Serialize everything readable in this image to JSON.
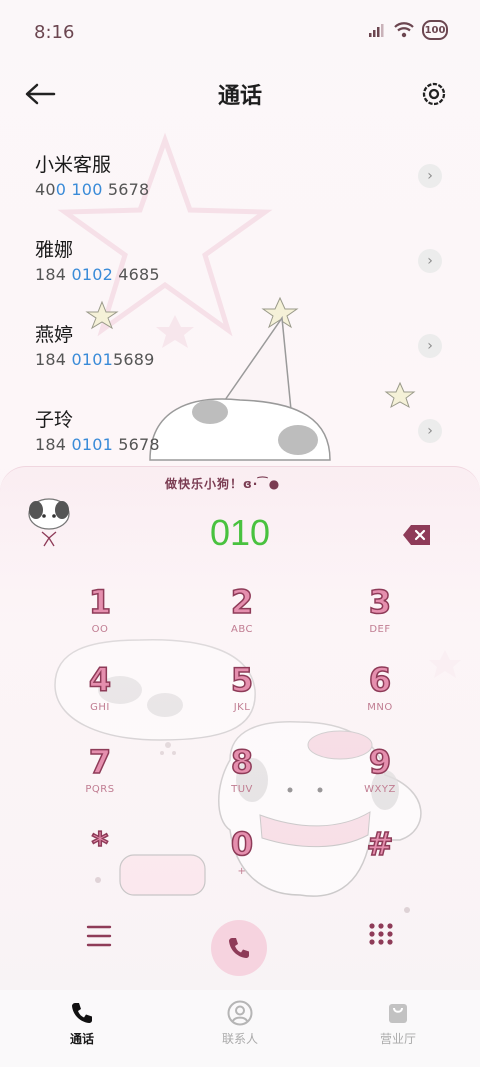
{
  "status_bar": {
    "time": "8:16",
    "battery": "100"
  },
  "header": {
    "title": "通话"
  },
  "suggestions": [
    {
      "name": "小米客服",
      "num_pre": "40",
      "num_hl": "0 100",
      "num_post": " 5678"
    },
    {
      "name": "雅娜",
      "num_pre": "184 ",
      "num_hl": "0102",
      "num_post": " 4685"
    },
    {
      "name": "燕婷",
      "num_pre": "184 ",
      "num_hl": "0101",
      "num_post": "5689"
    },
    {
      "name": "子玲",
      "num_pre": "184 ",
      "num_hl": "0101",
      "num_post": " 5678"
    }
  ],
  "dialer": {
    "banner": "做快乐小狗！ɞ·  ͡  ●",
    "number": "010",
    "keys": [
      {
        "digit": "1",
        "letters": "OO"
      },
      {
        "digit": "2",
        "letters": "ABC"
      },
      {
        "digit": "3",
        "letters": "DEF"
      },
      {
        "digit": "4",
        "letters": "GHI"
      },
      {
        "digit": "5",
        "letters": "JKL"
      },
      {
        "digit": "6",
        "letters": "MNO"
      },
      {
        "digit": "7",
        "letters": "PQRS"
      },
      {
        "digit": "8",
        "letters": "TUV"
      },
      {
        "digit": "9",
        "letters": "WXYZ"
      },
      {
        "digit": "*",
        "letters": ""
      },
      {
        "digit": "0",
        "letters": "+"
      },
      {
        "digit": "#",
        "letters": ""
      }
    ]
  },
  "bottom_nav": [
    {
      "label": "通话",
      "icon": "phone-icon",
      "active": true
    },
    {
      "label": "联系人",
      "icon": "contacts-icon",
      "active": false
    },
    {
      "label": "营业厅",
      "icon": "shopping-bag-icon",
      "active": false
    }
  ],
  "colors": {
    "accent_pink": "#e58fae",
    "digit_outline": "#8e3b58",
    "number_green": "#49c23f",
    "highlight_blue": "#3a8bd8"
  }
}
